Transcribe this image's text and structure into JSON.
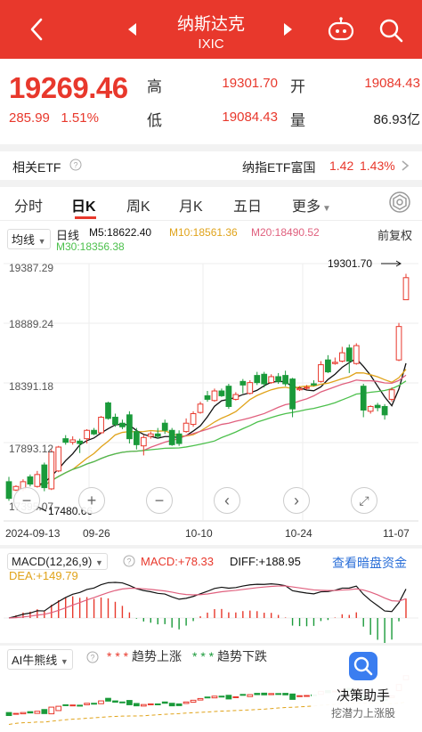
{
  "header": {
    "title": "纳斯达克",
    "subtitle": "IXIC"
  },
  "quote": {
    "price": "19269.46",
    "change": "285.99",
    "change_pct": "1.51%",
    "high_label": "高",
    "high": "19301.70",
    "open_label": "开",
    "open": "19084.43",
    "low_label": "低",
    "low": "19084.43",
    "volume_label": "量",
    "volume": "86.93亿"
  },
  "etf": {
    "label": "相关ETF",
    "name": "纳指ETF富国",
    "price": "1.42",
    "pct": "1.43%"
  },
  "tabs": [
    "分时",
    "日K",
    "周K",
    "月K",
    "五日",
    "更多"
  ],
  "active_tab": "日K",
  "ma": {
    "mode": "均线",
    "type": "日线",
    "ma5": "M5:18622.40",
    "ma10": "M10:18561.36",
    "ma20": "M20:18490.52",
    "ma30": "M30:18356.38",
    "adjust": "前复权"
  },
  "colors": {
    "up": "#e8382c",
    "down": "#1a9a3a",
    "ma5": "#111111",
    "ma10": "#e0a31a",
    "ma20": "#e0607e",
    "ma30": "#4cc04c"
  },
  "chart": {
    "y_labels": [
      "19387.29",
      "18889.24",
      "18391.18",
      "17893.12",
      "17395.07"
    ],
    "x_labels": [
      "2024-09-13",
      "09-26",
      "10-10",
      "10-24",
      "11-07"
    ],
    "high_marker": "19301.70",
    "low_marker": "17480.66"
  },
  "chart_data": {
    "type": "candlestick",
    "ylim": [
      17395.07,
      19387.29
    ],
    "candles": [
      {
        "o": 17560,
        "c": 17420,
        "h": 17600,
        "l": 17400
      },
      {
        "o": 17490,
        "c": 17520,
        "h": 17530,
        "l": 17480.66
      },
      {
        "o": 17500,
        "c": 17560,
        "h": 17580,
        "l": 17480
      },
      {
        "o": 17600,
        "c": 17540,
        "h": 17620,
        "l": 17520
      },
      {
        "o": 17520,
        "c": 17620,
        "h": 17650,
        "l": 17510
      },
      {
        "o": 17700,
        "c": 17510,
        "h": 17720,
        "l": 17480
      },
      {
        "o": 17500,
        "c": 17810,
        "h": 17830,
        "l": 17490
      },
      {
        "o": 17650,
        "c": 17850,
        "h": 17860,
        "l": 17640
      },
      {
        "o": 17920,
        "c": 17890,
        "h": 17950,
        "l": 17870
      },
      {
        "o": 17890,
        "c": 17910,
        "h": 17940,
        "l": 17870
      },
      {
        "o": 17900,
        "c": 17880,
        "h": 17920,
        "l": 17800
      },
      {
        "o": 17920,
        "c": 17990,
        "h": 18000,
        "l": 17880
      },
      {
        "o": 17990,
        "c": 17960,
        "h": 18010,
        "l": 17950
      },
      {
        "o": 17970,
        "c": 18100,
        "h": 18110,
        "l": 17960
      },
      {
        "o": 18220,
        "c": 18090,
        "h": 18230,
        "l": 18080
      },
      {
        "o": 18100,
        "c": 18040,
        "h": 18130,
        "l": 18020
      },
      {
        "o": 18050,
        "c": 18020,
        "h": 18080,
        "l": 18000
      },
      {
        "o": 18120,
        "c": 17920,
        "h": 18150,
        "l": 17880
      },
      {
        "o": 17980,
        "c": 17870,
        "h": 18010,
        "l": 17830
      },
      {
        "o": 17860,
        "c": 17930,
        "h": 17950,
        "l": 17780
      },
      {
        "o": 17940,
        "c": 17960,
        "h": 17980,
        "l": 17920
      },
      {
        "o": 17960,
        "c": 17940,
        "h": 18010,
        "l": 17920
      },
      {
        "o": 18050,
        "c": 17990,
        "h": 18080,
        "l": 17960
      },
      {
        "o": 17990,
        "c": 17870,
        "h": 18010,
        "l": 17860
      },
      {
        "o": 17960,
        "c": 17880,
        "h": 17990,
        "l": 17860
      },
      {
        "o": 17980,
        "c": 18050,
        "h": 18090,
        "l": 17970
      },
      {
        "o": 18040,
        "c": 18130,
        "h": 18150,
        "l": 18020
      },
      {
        "o": 18140,
        "c": 18210,
        "h": 18230,
        "l": 18130
      },
      {
        "o": 18280,
        "c": 18250,
        "h": 18320,
        "l": 18230
      },
      {
        "o": 18240,
        "c": 18320,
        "h": 18340,
        "l": 18230
      },
      {
        "o": 18320,
        "c": 18280,
        "h": 18340,
        "l": 18270
      },
      {
        "o": 18360,
        "c": 18190,
        "h": 18380,
        "l": 18170
      },
      {
        "o": 18250,
        "c": 18290,
        "h": 18310,
        "l": 18240
      },
      {
        "o": 18400,
        "c": 18370,
        "h": 18420,
        "l": 18300
      },
      {
        "o": 18300,
        "c": 18390,
        "h": 18410,
        "l": 18290
      },
      {
        "o": 18450,
        "c": 18390,
        "h": 18480,
        "l": 18370
      },
      {
        "o": 18460,
        "c": 18380,
        "h": 18480,
        "l": 18350
      },
      {
        "o": 18390,
        "c": 18440,
        "h": 18460,
        "l": 18380
      },
      {
        "o": 18440,
        "c": 18400,
        "h": 18470,
        "l": 18380
      },
      {
        "o": 18450,
        "c": 18380,
        "h": 18490,
        "l": 18360
      },
      {
        "o": 18420,
        "c": 18170,
        "h": 18430,
        "l": 18100
      },
      {
        "o": 18330,
        "c": 18340,
        "h": 18360,
        "l": 18320
      },
      {
        "o": 18350,
        "c": 18350,
        "h": 18370,
        "l": 18330
      },
      {
        "o": 18380,
        "c": 18370,
        "h": 18410,
        "l": 18360
      },
      {
        "o": 18400,
        "c": 18540,
        "h": 18570,
        "l": 18390
      },
      {
        "o": 18580,
        "c": 18480,
        "h": 18620,
        "l": 18470
      },
      {
        "o": 18550,
        "c": 18560,
        "h": 18600,
        "l": 18540
      },
      {
        "o": 18570,
        "c": 18640,
        "h": 18690,
        "l": 18560
      },
      {
        "o": 18680,
        "c": 18570,
        "h": 18710,
        "l": 18470
      },
      {
        "o": 18550,
        "c": 18700,
        "h": 18720,
        "l": 18540
      },
      {
        "o": 18360,
        "c": 18160,
        "h": 18380,
        "l": 18100
      },
      {
        "o": 18150,
        "c": 18190,
        "h": 18200,
        "l": 18130
      },
      {
        "o": 18200,
        "c": 18180,
        "h": 18220,
        "l": 18150
      },
      {
        "o": 18190,
        "c": 18120,
        "h": 18210,
        "l": 18080
      },
      {
        "o": 18250,
        "c": 18330,
        "h": 18350,
        "l": 18230
      },
      {
        "o": 18580,
        "c": 18860,
        "h": 18890,
        "l": 18570
      },
      {
        "o": 19084.43,
        "c": 19269.46,
        "h": 19301.7,
        "l": 19084.43
      }
    ]
  },
  "macd": {
    "label": "MACD(12,26,9)",
    "macd": "MACD:+78.33",
    "diff": "DIFF:+188.95",
    "dea": "DEA:+149.79",
    "link": "查看暗盘资金"
  },
  "ai": {
    "label": "AI牛熊线",
    "up": "趋势上涨",
    "down": "趋势下跌",
    "assist_title": "决策助手",
    "assist_sub": "挖潜力上涨股"
  }
}
